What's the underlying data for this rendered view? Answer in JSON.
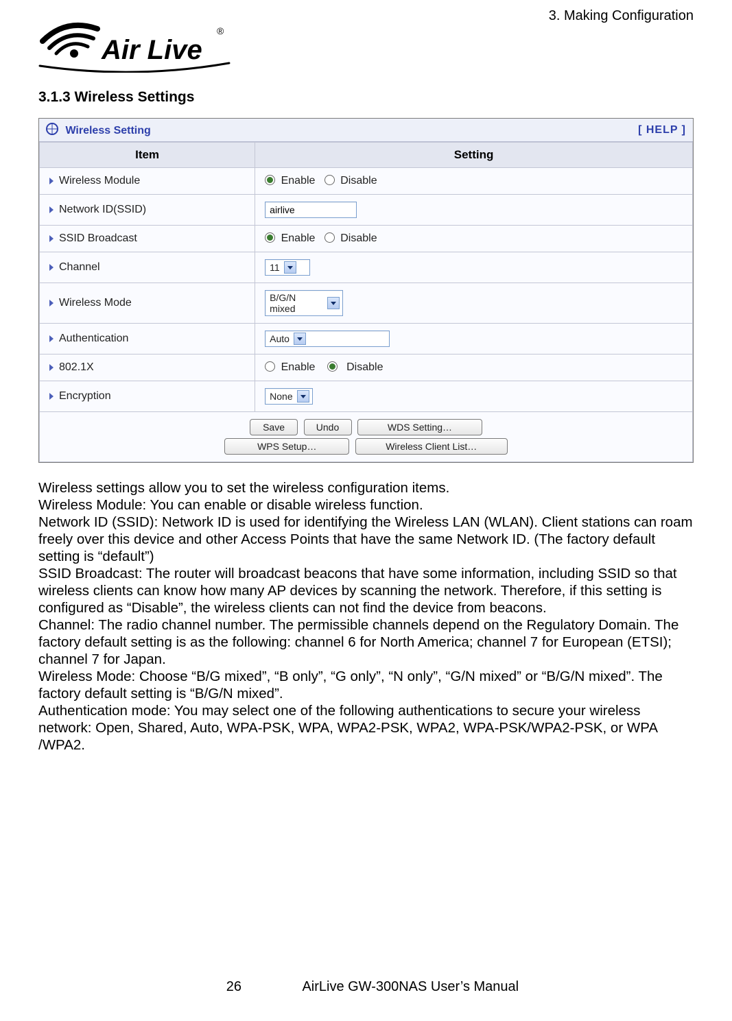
{
  "header": {
    "chapter": "3. Making Configuration",
    "logo_brand": "Air Live",
    "logo_tm": "®"
  },
  "section": {
    "number": "3.1.3 Wireless Settings"
  },
  "panel": {
    "title": "Wireless Setting",
    "help": "[ HELP ]",
    "columns": {
      "item": "Item",
      "setting": "Setting"
    }
  },
  "rows": {
    "wireless_module": {
      "label": "Wireless Module"
    },
    "ssid": {
      "label": "Network ID(SSID)",
      "value": "airlive"
    },
    "ssid_broadcast": {
      "label": "SSID Broadcast"
    },
    "channel": {
      "label": "Channel",
      "value": "11"
    },
    "wireless_mode": {
      "label": "Wireless Mode",
      "value": "B/G/N mixed"
    },
    "auth": {
      "label": "Authentication",
      "value": "Auto"
    },
    "x8021": {
      "label": "802.1X"
    },
    "encryption": {
      "label": "Encryption",
      "value": "None"
    }
  },
  "radio_labels": {
    "enable": "Enable",
    "disable": "Disable"
  },
  "buttons": {
    "save": "Save",
    "undo": "Undo",
    "wds": "WDS Setting…",
    "wps": "WPS Setup…",
    "clients": "Wireless Client List…"
  },
  "explain": {
    "p1": "Wireless settings allow you to set the wireless configuration items.",
    "p2": "Wireless Module: You can enable or disable wireless function.",
    "p3": "Network ID (SSID): Network ID is used for identifying the Wireless LAN (WLAN). Client stations can roam freely over this device and other Access Points that have the same Network ID. (The factory default setting is “default”)",
    "p4": "SSID Broadcast: The router will broadcast beacons that have some information, including SSID so that wireless clients can know how many AP devices by scanning the network. Therefore, if this setting is configured as “Disable”, the wireless clients can not find the device from beacons.",
    "p5": "Channel: The radio channel number. The permissible channels depend on the Regulatory Domain. The factory default setting is as the following: channel 6 for North America; channel 7 for European (ETSI); channel 7 for Japan.",
    "p6": "Wireless Mode: Choose “B/G mixed”, “B only”, “G only”, “N only”, “G/N mixed” or “B/G/N mixed”. The factory default setting is “B/G/N mixed”.",
    "p7": "Authentication mode: You may select one of the following authentications to secure your wireless network: Open, Shared, Auto, WPA-PSK, WPA, WPA2-PSK, WPA2, WPA-PSK/WPA2-PSK, or WPA /WPA2."
  },
  "footer": {
    "page": "26",
    "manual": "AirLive GW-300NAS User’s Manual"
  }
}
